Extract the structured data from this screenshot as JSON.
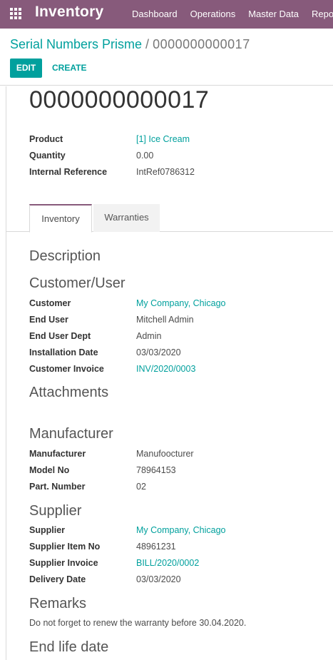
{
  "navbar": {
    "app_title": "Inventory",
    "menu": [
      "Dashboard",
      "Operations",
      "Master Data",
      "Repo"
    ],
    "color": "#875a7b"
  },
  "breadcrumb": {
    "parent": "Serial Numbers Prisme",
    "separator": "/",
    "current": "0000000000017"
  },
  "buttons": {
    "edit": "EDIT",
    "create": "CREATE"
  },
  "record": {
    "title": "0000000000017",
    "fields": [
      {
        "label": "Product",
        "value": "[1] Ice Cream",
        "link": true
      },
      {
        "label": "Quantity",
        "value": "0.00",
        "link": false
      },
      {
        "label": "Internal Reference",
        "value": "IntRef0786312",
        "link": false
      }
    ]
  },
  "tabs": [
    {
      "label": "Inventory",
      "active": true
    },
    {
      "label": "Warranties",
      "active": false
    }
  ],
  "sections": {
    "description": "Description",
    "customer_user": {
      "title": "Customer/User",
      "fields": [
        {
          "label": "Customer",
          "value": "My Company, Chicago",
          "link": true
        },
        {
          "label": "End User",
          "value": "Mitchell Admin",
          "link": false
        },
        {
          "label": "End User Dept",
          "value": "Admin",
          "link": false
        },
        {
          "label": "Installation Date",
          "value": "03/03/2020",
          "link": false
        },
        {
          "label": "Customer Invoice",
          "value": "INV/2020/0003",
          "link": true
        }
      ]
    },
    "attachments": "Attachments",
    "manufacturer": {
      "title": "Manufacturer",
      "fields": [
        {
          "label": "Manufacturer",
          "value": "Manufoocturer",
          "link": false
        },
        {
          "label": "Model No",
          "value": "78964153",
          "link": false
        },
        {
          "label": "Part. Number",
          "value": "02",
          "link": false
        }
      ]
    },
    "supplier": {
      "title": "Supplier",
      "fields": [
        {
          "label": "Supplier",
          "value": "My Company, Chicago",
          "link": true
        },
        {
          "label": "Supplier Item No",
          "value": "48961231",
          "link": false
        },
        {
          "label": "Supplier Invoice",
          "value": "BILL/2020/0002",
          "link": true
        },
        {
          "label": "Delivery Date",
          "value": "03/03/2020",
          "link": false
        }
      ]
    },
    "remarks": {
      "title": "Remarks",
      "text": "Do not forget to renew the warranty before 30.04.2020."
    },
    "end_life": "End life date"
  }
}
